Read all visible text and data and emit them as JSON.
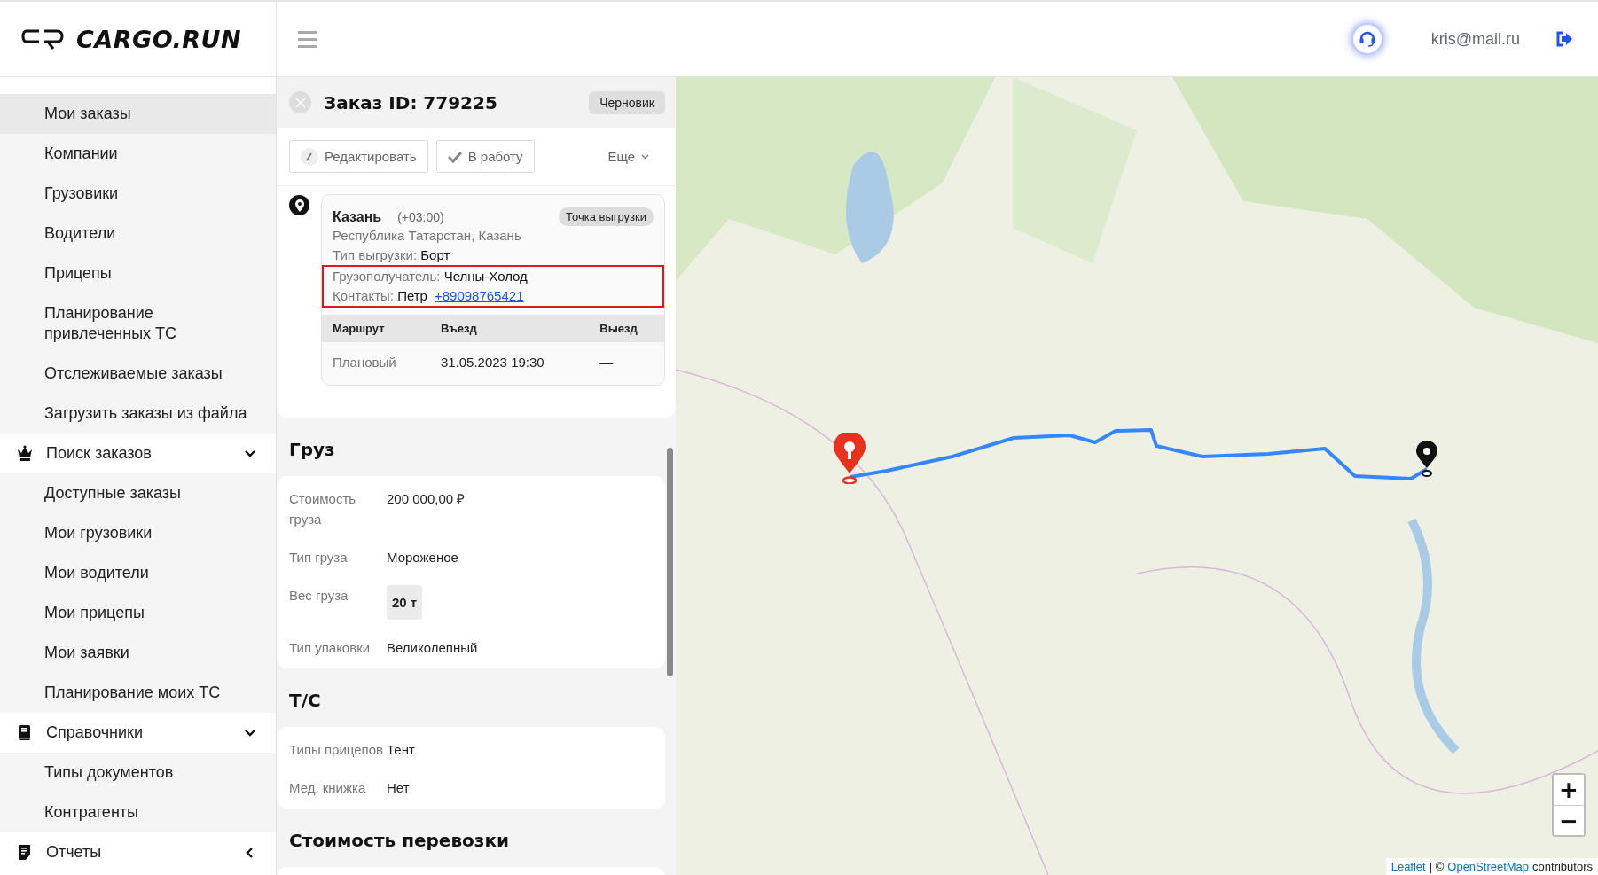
{
  "header": {
    "logo_text": "CARGO.RUN",
    "user_email": "kris@mail.ru"
  },
  "sidebar": {
    "sections": [
      {
        "items": [
          {
            "label": "Мои заказы",
            "selected": true
          },
          {
            "label": "Компании",
            "selected": false
          },
          {
            "label": "Грузовики",
            "selected": false
          },
          {
            "label": "Водители",
            "selected": false
          },
          {
            "label": "Прицепы",
            "selected": false
          },
          {
            "label": "Планирование привлеченных ТС",
            "selected": false
          },
          {
            "label": "Отслеживаемые заказы",
            "selected": false
          },
          {
            "label": "Загрузить заказы из файла",
            "selected": false
          }
        ]
      },
      {
        "label": "Поиск заказов",
        "expanded": true,
        "items": [
          {
            "label": "Доступные заказы",
            "selected": false
          },
          {
            "label": "Мои грузовики",
            "selected": false
          },
          {
            "label": "Мои водители",
            "selected": false
          },
          {
            "label": "Мои прицепы",
            "selected": false
          },
          {
            "label": "Мои заявки",
            "selected": false
          },
          {
            "label": "Планирование моих ТС",
            "selected": false
          }
        ]
      },
      {
        "label": "Справочники",
        "expanded": true,
        "items": [
          {
            "label": "Типы документов",
            "selected": false
          },
          {
            "label": "Контрагенты",
            "selected": false
          }
        ]
      },
      {
        "label": "Отчеты",
        "expanded": false
      }
    ]
  },
  "order": {
    "title": "Заказ ID: 779225",
    "status": "Черновик",
    "actions": [
      {
        "label": "Редактировать"
      },
      {
        "label": "В работу"
      }
    ],
    "more_label": "Еще",
    "stop": {
      "city": "Казань",
      "timezone": "(+03:00)",
      "type_badge": "Точка выгрузки",
      "address": "Республика Татарстан, Казань",
      "fields": [
        {
          "label": "Тип выгрузки:",
          "value": "Борт",
          "highlighted": false
        },
        {
          "label": "Грузополучатель:",
          "value": "Челны-Холод",
          "highlighted": true
        },
        {
          "label": "Контакты:",
          "value": "Петр",
          "link": "+89098765421",
          "highlighted": true
        }
      ],
      "table": {
        "columns": [
          "Маршрут",
          "Въезд",
          "Выезд"
        ],
        "rows": [
          [
            "Плановый",
            "31.05.2023 19:30",
            "—"
          ]
        ]
      }
    },
    "sections": [
      {
        "title": "Груз",
        "fields": [
          {
            "label": "Стоимость груза",
            "value": "200 000,00 ₽",
            "kind": "text"
          },
          {
            "label": "Тип груза",
            "value": "Мороженое",
            "kind": "text"
          },
          {
            "label": "Вес груза",
            "value": "20 т",
            "kind": "chip"
          },
          {
            "label": "Тип упаковки",
            "value": "Великолепный",
            "kind": "text"
          }
        ]
      },
      {
        "title": "Т/С",
        "fields": [
          {
            "label": "Типы прицепов",
            "value": "Тент",
            "kind": "text"
          },
          {
            "label": "Мед. книжка",
            "value": "Нет",
            "kind": "text"
          }
        ]
      },
      {
        "title": "Стоимость перевозки"
      }
    ]
  },
  "map": {
    "zoom_in": "+",
    "zoom_out": "−",
    "attribution": [
      {
        "text": "Leaflet",
        "kind": "link"
      },
      {
        "text": "| ©",
        "kind": "text"
      },
      {
        "text": "OpenStreetMap",
        "kind": "link"
      },
      {
        "text": "contributors",
        "kind": "text"
      }
    ]
  }
}
